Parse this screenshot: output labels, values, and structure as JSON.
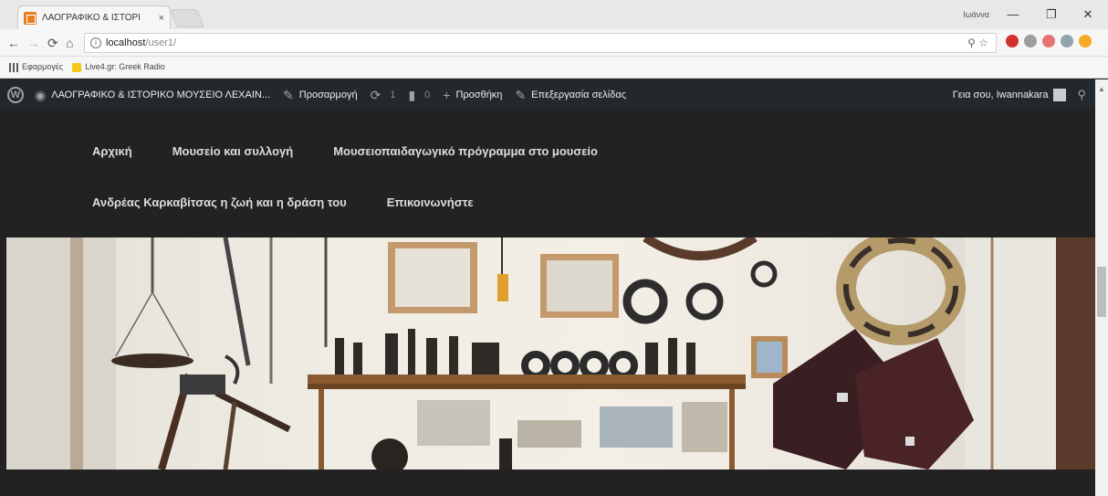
{
  "browser": {
    "tab_title": "ΛΑΟΓΡΑΦΙΚΟ & ΙΣΤΟΡΙ",
    "tab_close": "×",
    "profile_label": "Ιωάννα",
    "window_minimize": "—",
    "window_maximize": "❐",
    "window_close": "✕",
    "address_host": "localhost",
    "address_path": "/user1/",
    "bookmarks": [
      {
        "label": "Εφαρμογές"
      },
      {
        "label": "Live4.gr: Greek Radio"
      }
    ]
  },
  "admin_bar": {
    "site_name": "ΛΑΟΓΡΑΦΙΚΟ & ΙΣΤΟΡΙΚΟ ΜΟΥΣΕΙΟ ΛΕΧΑΙΝ...",
    "customize": "Προσαρμογή",
    "updates_count": "1",
    "comments_count": "0",
    "new": "Προσθήκη",
    "edit_page": "Επεξεργασία σελίδας",
    "greeting": "Γεια σου, Iwannakara"
  },
  "menu": {
    "row1": [
      "Αρχική",
      "Μουσείο και συλλογή",
      "Μουσειοπαιδαγωγικό πρόγραμμα στο μουσείο"
    ],
    "row2": [
      "Ανδρέας Καρκαβίτσας η ζωή και η δράση του",
      "Επικοινωνήστε"
    ]
  },
  "colors": {
    "admin_bar": "#23282d",
    "site_bg": "#222222",
    "menu_text": "#dddddd"
  }
}
